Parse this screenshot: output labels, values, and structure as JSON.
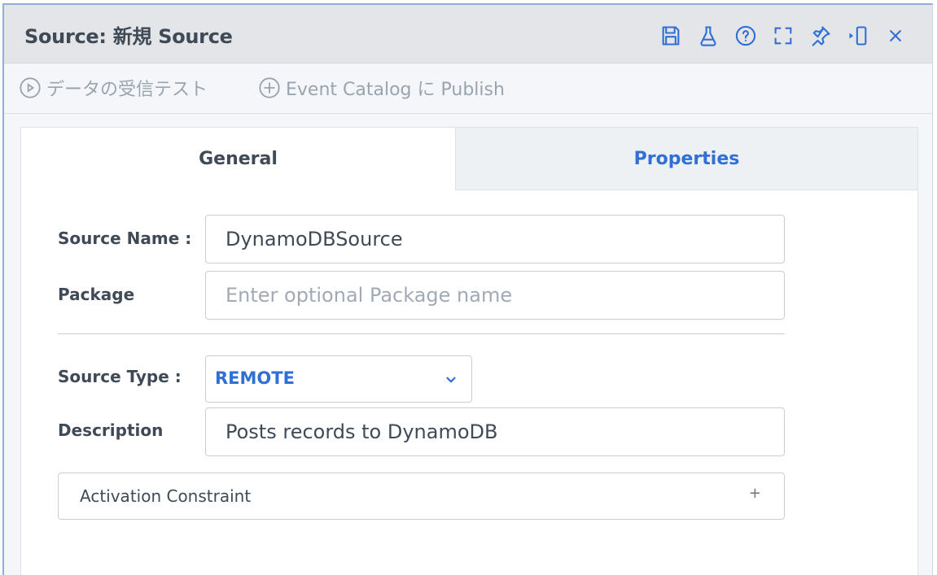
{
  "window": {
    "title": "Source: 新規 Source",
    "icons": [
      "save-icon",
      "flask-icon",
      "help-icon",
      "expand-icon",
      "pin-icon",
      "dock-icon",
      "close-icon"
    ],
    "close_glyph": "×"
  },
  "toolbar": {
    "receive_test_label": "データの受信テスト",
    "publish_label": "Event Catalog に Publish"
  },
  "tabs": [
    {
      "label": "General",
      "active": true
    },
    {
      "label": "Properties",
      "active": false
    }
  ],
  "form": {
    "source_name_label": "Source Name :",
    "source_name_value": "DynamoDBSource",
    "package_label": "Package",
    "package_placeholder": "Enter optional Package name",
    "source_type_label": "Source Type :",
    "source_type_value": "REMOTE",
    "description_label": "Description",
    "description_value": "Posts records to DynamoDB",
    "activation_label": "Activation Constraint",
    "activation_toggle": "+"
  },
  "colors": {
    "accent": "#2f6fd6",
    "header_bg": "#e3e5e8",
    "muted_text": "#9aa4af"
  }
}
